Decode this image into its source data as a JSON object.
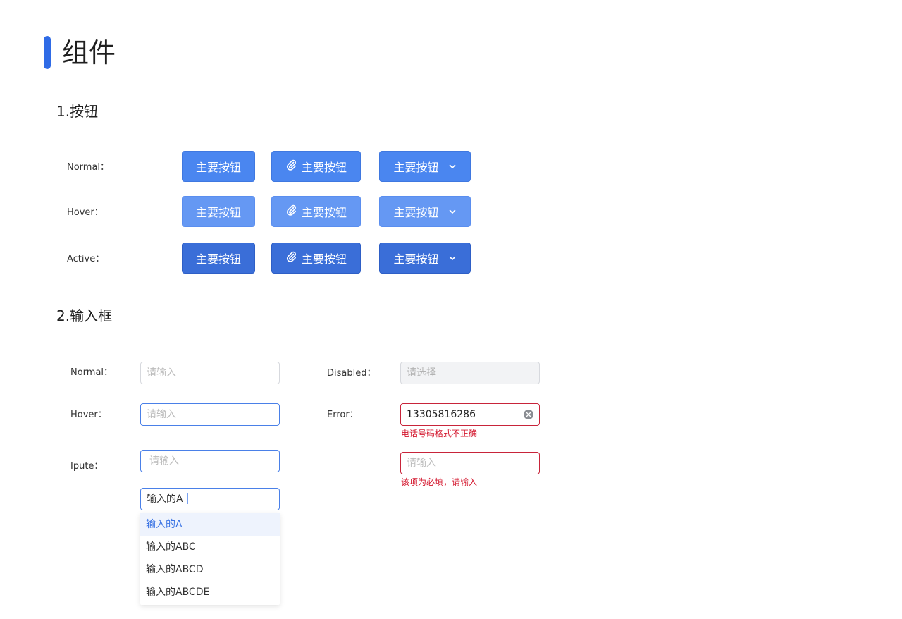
{
  "page": {
    "title": "组件"
  },
  "colors": {
    "accent": "#2f6be6",
    "button_normal": "#4a86f0",
    "button_hover": "#6598f3",
    "button_active": "#3a6ed8",
    "input_focus_border": "#4a80e8",
    "error": "#d4182f"
  },
  "buttons_section": {
    "title": "1.按钮",
    "rows": [
      {
        "label": "Normal：",
        "state": "normal"
      },
      {
        "label": "Hover：",
        "state": "hover"
      },
      {
        "label": "Active：",
        "state": "active"
      }
    ],
    "button_label": "主要按钮",
    "icons": {
      "icon_button": "paperclip-icon",
      "dropdown_button": "chevron-down-icon"
    }
  },
  "inputs_section": {
    "title": "2.输入框",
    "normal": {
      "label": "Normal：",
      "placeholder": "请输入"
    },
    "hover": {
      "label": "Hover：",
      "placeholder": "请输入"
    },
    "input": {
      "label": "Ipute：",
      "placeholder": "请输入",
      "typed_value": "输入的A",
      "suggestions": [
        "输入的A",
        "输入的ABC",
        "输入的ABCD",
        "输入的ABCDE"
      ],
      "selected_index": 0
    },
    "disabled": {
      "label": "Disabled：",
      "placeholder": "请选择"
    },
    "error": {
      "label": "Error：",
      "value": "13305816286",
      "message": "电话号码格式不正确",
      "required_placeholder": "请输入",
      "required_message": "该项为必填，请输入"
    }
  }
}
